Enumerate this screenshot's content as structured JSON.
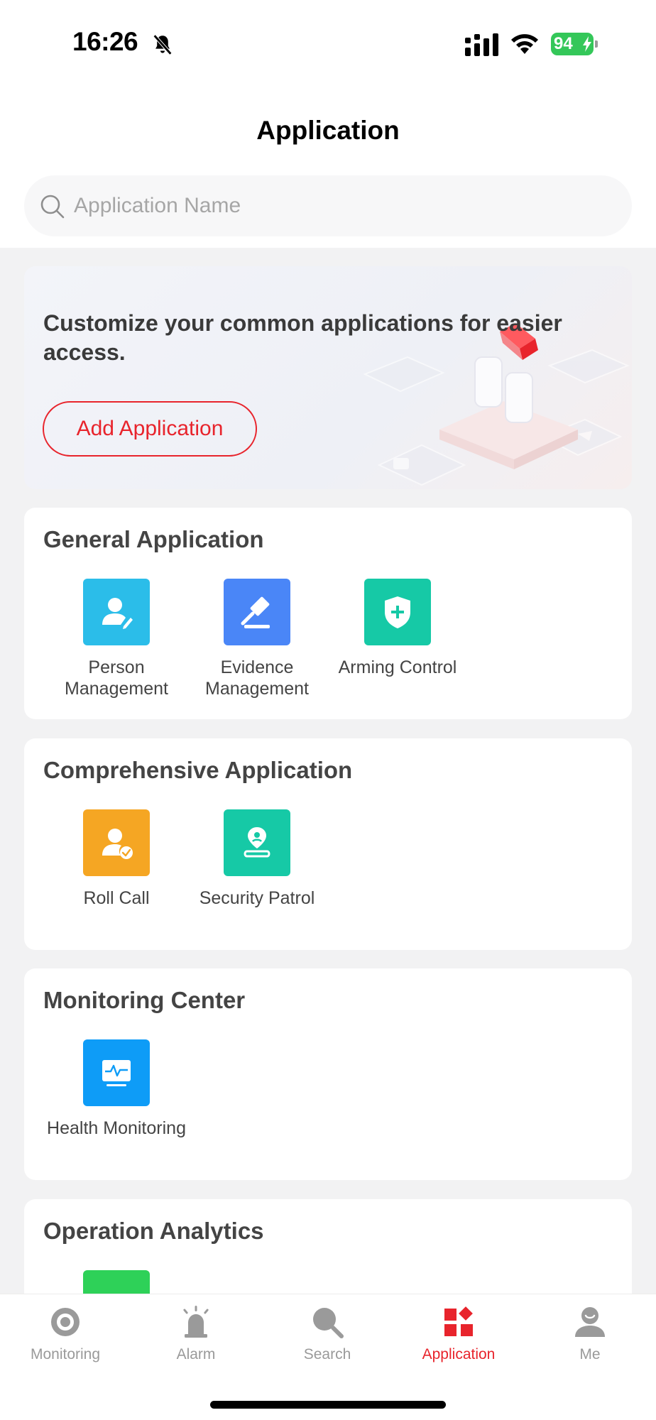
{
  "status_bar": {
    "time": "16:26",
    "battery": "94"
  },
  "header": {
    "title": "Application"
  },
  "search": {
    "placeholder": "Application Name"
  },
  "banner": {
    "text": "Customize your common applications for easier access.",
    "button_label": "Add Application"
  },
  "sections": [
    {
      "title": "General Application",
      "apps": [
        {
          "label": "Person Management",
          "icon": "person-edit-icon",
          "color": "#2bbde9"
        },
        {
          "label": "Evidence Management",
          "icon": "gavel-icon",
          "color": "#4a86f7"
        },
        {
          "label": "Arming Control",
          "icon": "shield-plus-icon",
          "color": "#16c9a6"
        }
      ]
    },
    {
      "title": "Comprehensive Application",
      "apps": [
        {
          "label": "Roll Call",
          "icon": "person-check-icon",
          "color": "#f5a623"
        },
        {
          "label": "Security Patrol",
          "icon": "patrol-route-icon",
          "color": "#16c9a6"
        }
      ]
    },
    {
      "title": "Monitoring Center",
      "apps": [
        {
          "label": "Health Monitoring",
          "icon": "monitor-pulse-icon",
          "color": "#0e9cf7"
        }
      ]
    },
    {
      "title": "Operation Analytics",
      "apps": [
        {
          "label": "",
          "icon": "trend-chart-icon",
          "color": "#2ed158"
        }
      ]
    }
  ],
  "tabbar": {
    "items": [
      {
        "label": "Monitoring",
        "icon": "monitoring-icon",
        "active": false
      },
      {
        "label": "Alarm",
        "icon": "alarm-siren-icon",
        "active": false
      },
      {
        "label": "Search",
        "icon": "search-icon",
        "active": false
      },
      {
        "label": "Application",
        "icon": "application-grid-icon",
        "active": true
      },
      {
        "label": "Me",
        "icon": "person-icon",
        "active": false
      }
    ]
  },
  "colors": {
    "accent": "#e8242c",
    "active_tab": "#e8242c",
    "inactive_tab": "#9a9a9a"
  }
}
